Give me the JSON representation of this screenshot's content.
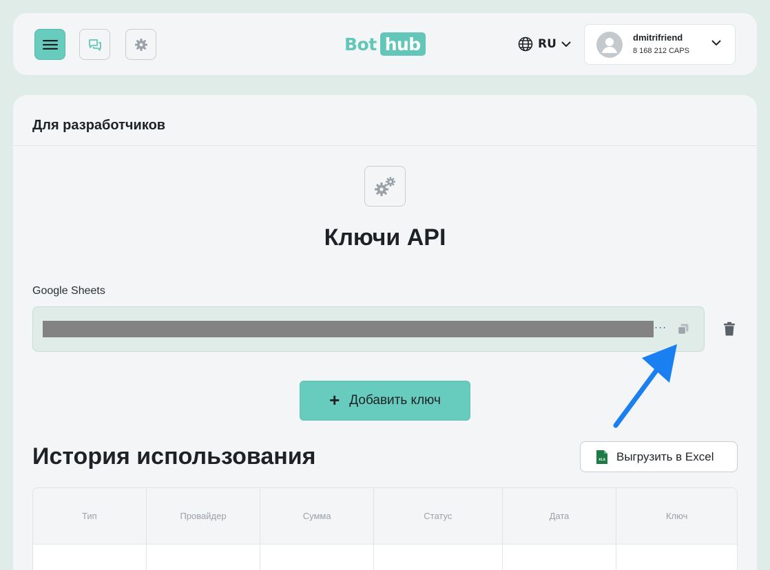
{
  "header": {
    "logo": {
      "bot": "Bot",
      "hub": "hub"
    },
    "language": "RU",
    "user": {
      "name": "dmitrifriend",
      "balance": "8 168 212 CAPS"
    },
    "icons": [
      "menu-icon",
      "chat-icon",
      "gear-icon",
      "globe-icon",
      "chevron-down-icon",
      "user-icon"
    ]
  },
  "page": {
    "section_title": "Для разработчиков",
    "api_title": "Ключи API",
    "key": {
      "label": "Google Sheets",
      "value": "••••••••••••••••••••••••••••••••••••••••••••••••••••••••••••••••••••••",
      "ellipsis": "..."
    },
    "add_key_label": "Добавить ключ",
    "add_key_plus": "+",
    "history_title": "История использования",
    "export_label": "Выгрузить в Excel",
    "export_icon_text": "XLS",
    "table": {
      "columns": [
        "Тип",
        "Провайдер",
        "Сумма",
        "Статус",
        "Дата",
        "Ключ"
      ]
    }
  },
  "colors": {
    "accent": "#67ccbd",
    "page_bg": "#dfece8",
    "card_bg": "#f3f5f6",
    "annotation_arrow": "#1a7ff0"
  }
}
